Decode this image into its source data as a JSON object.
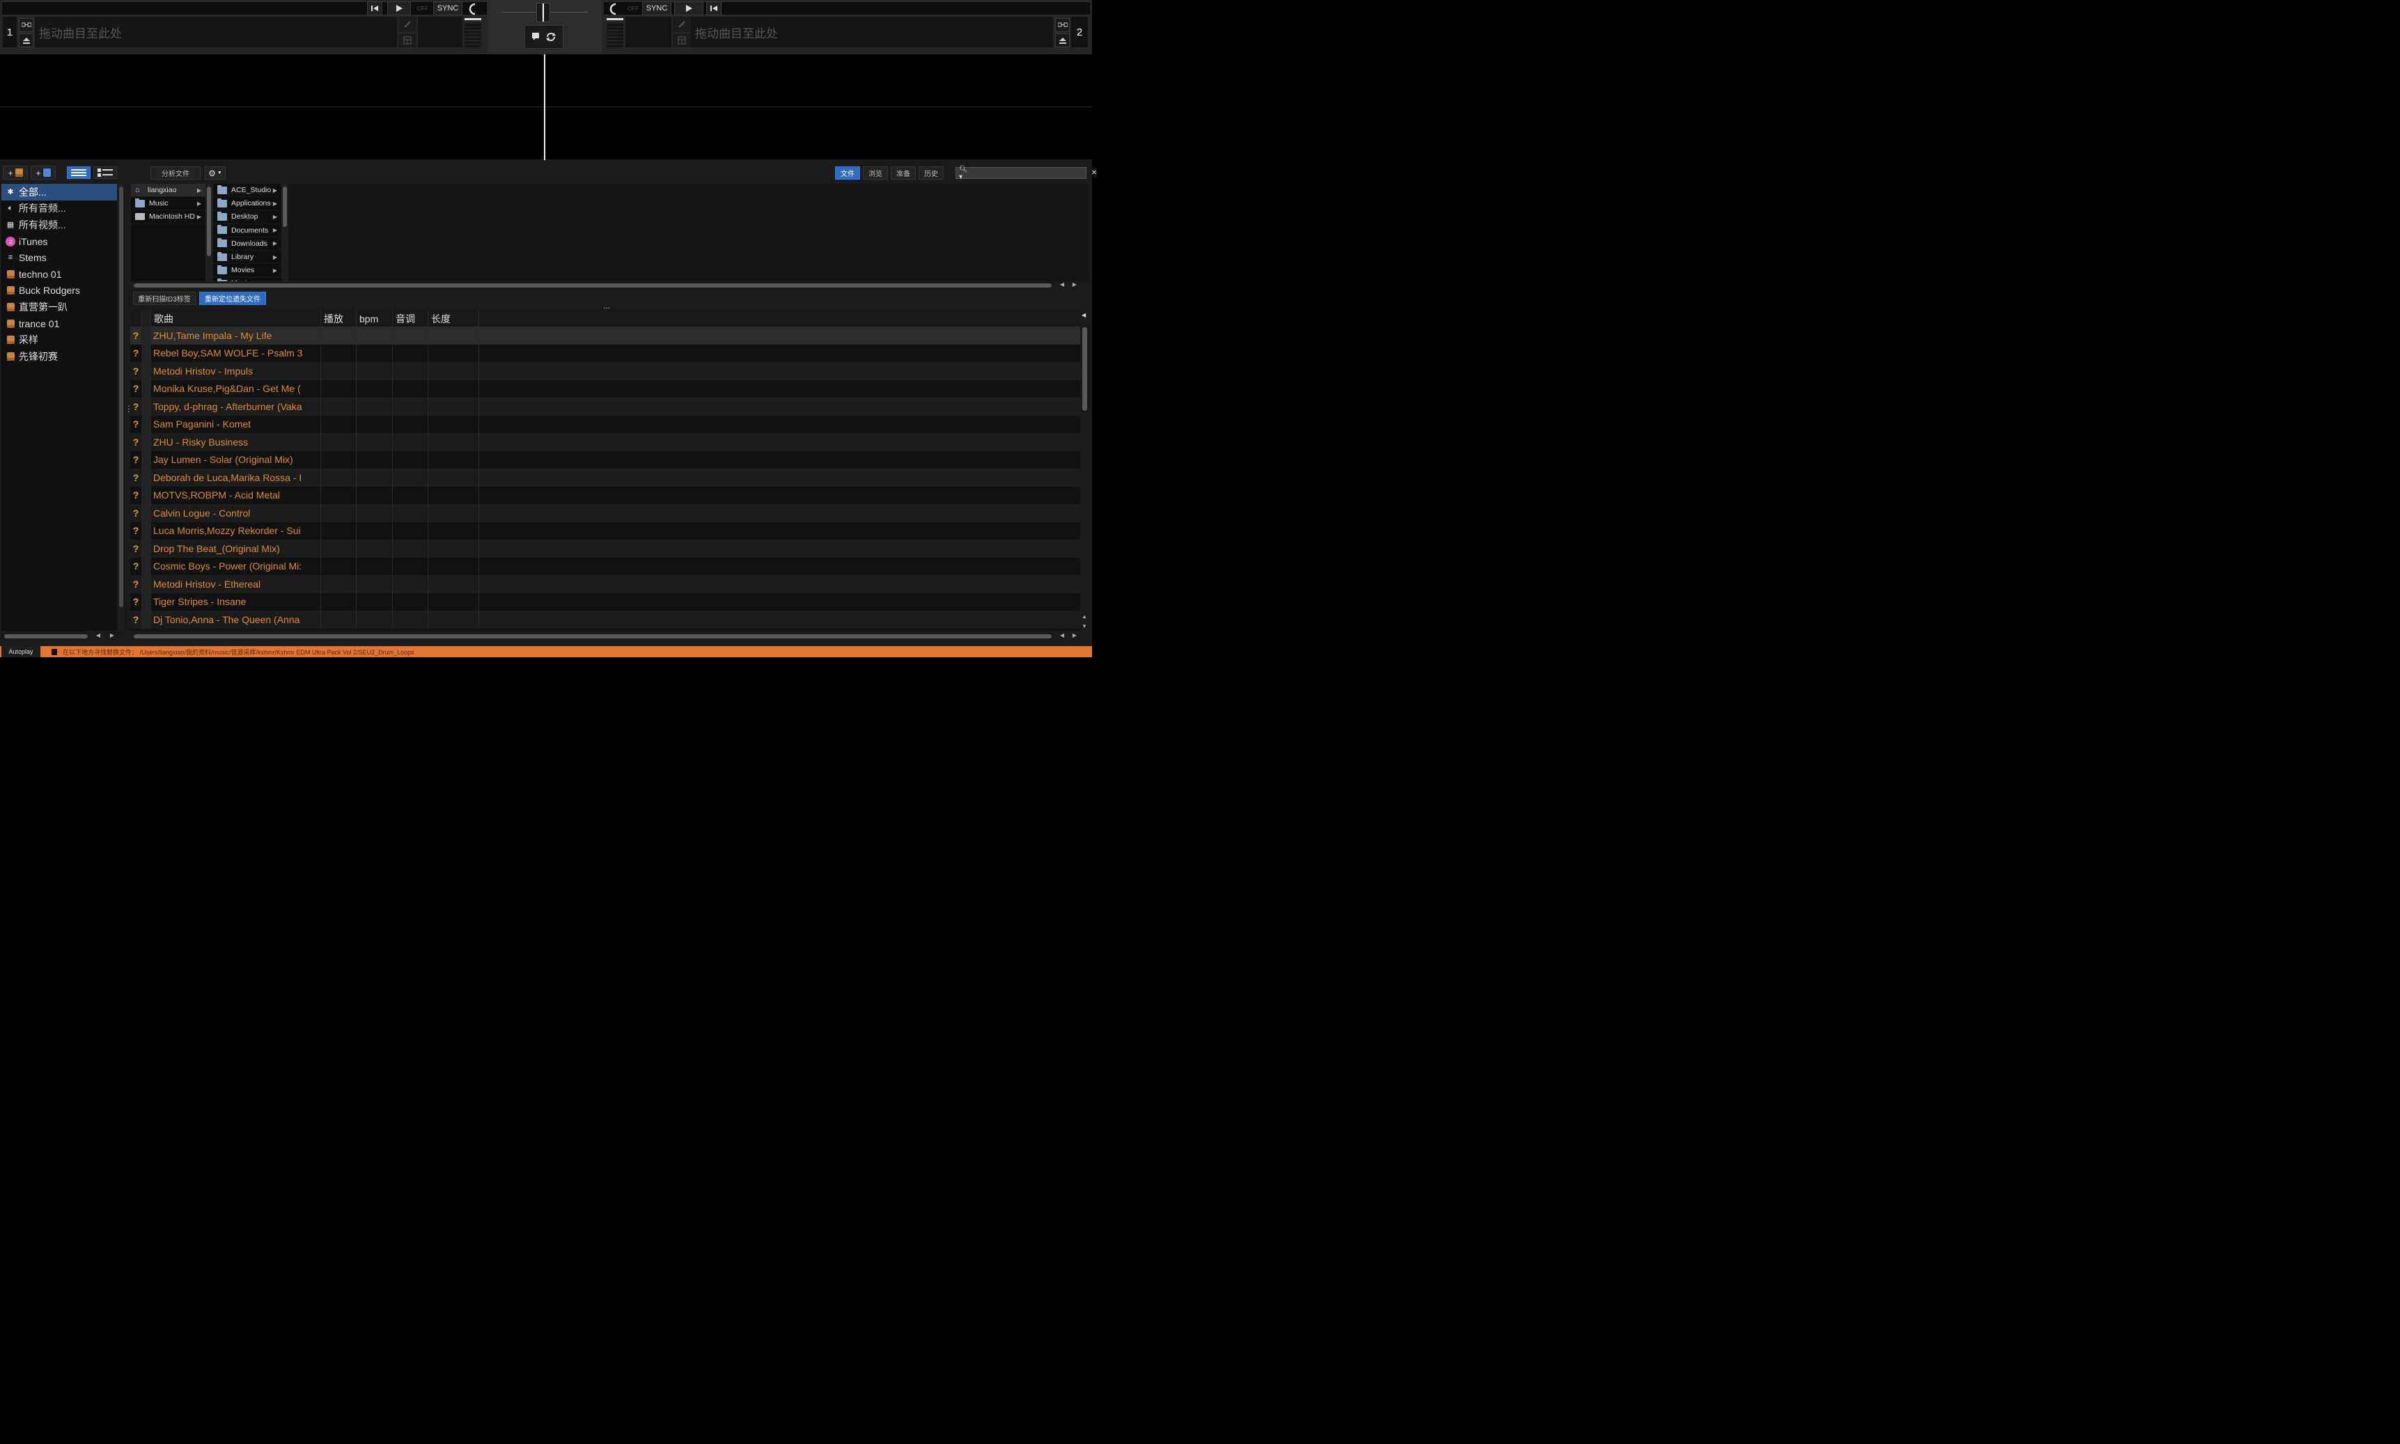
{
  "deck1": {
    "number": "1",
    "drop_hint": "拖动曲目至此处",
    "sync_label": "SYNC",
    "off_label": "OFF"
  },
  "deck2": {
    "number": "2",
    "drop_hint": "拖动曲目至此处",
    "sync_label": "SYNC",
    "off_label": "OFF"
  },
  "toolbar": {
    "analyze_label": "分析文件",
    "tabs": [
      {
        "label": "文件",
        "active": true
      },
      {
        "label": "浏览",
        "active": false
      },
      {
        "label": "准备",
        "active": false
      },
      {
        "label": "历史",
        "active": false
      }
    ],
    "search_placeholder": ""
  },
  "sidebar": {
    "items": [
      {
        "label": "全部...",
        "icon": "asterisk-icon",
        "selected": true
      },
      {
        "label": "所有音频...",
        "icon": "speaker-icon"
      },
      {
        "label": "所有视频...",
        "icon": "film-icon"
      },
      {
        "label": "iTunes",
        "icon": "itunes-icon"
      },
      {
        "label": "Stems",
        "icon": "stems-icon"
      },
      {
        "label": "techno 01",
        "icon": "crate-icon"
      },
      {
        "label": "Buck Rodgers",
        "icon": "crate-icon"
      },
      {
        "label": "直营第一趴",
        "icon": "crate-icon"
      },
      {
        "label": "trance 01",
        "icon": "crate-icon"
      },
      {
        "label": "采样",
        "icon": "crate-icon"
      },
      {
        "label": "先锋初赛",
        "icon": "crate-icon"
      }
    ]
  },
  "file_browser": {
    "col1": [
      {
        "label": "liangxiao",
        "icon": "home-icon",
        "selected": true
      },
      {
        "label": "Music",
        "icon": "folder-icon"
      },
      {
        "label": "Macintosh HD",
        "icon": "drive-icon"
      }
    ],
    "col2": [
      {
        "label": "ACE_Studio"
      },
      {
        "label": "Applications"
      },
      {
        "label": "Desktop"
      },
      {
        "label": "Documents"
      },
      {
        "label": "Downloads"
      },
      {
        "label": "Library"
      },
      {
        "label": "Movies"
      },
      {
        "label": "Music"
      }
    ],
    "rescan_label": "重新扫描ID3标签",
    "relocate_label": "重新定位遗失文件"
  },
  "tracklist": {
    "columns": {
      "title": "歌曲",
      "plays": "播放",
      "bpm": "bpm",
      "key": "音调",
      "length": "长度"
    },
    "rows": [
      {
        "status": "?",
        "title": "ZHU,Tame Impala - My Life"
      },
      {
        "status": "?",
        "title": "Rebel Boy,SAM WOLFE - Psalm 3"
      },
      {
        "status": "?",
        "title": "Metodi Hristov - Impuls"
      },
      {
        "status": "?",
        "title": "Monika Kruse,Pig&Dan - Get Me ("
      },
      {
        "status": "?",
        "title": "Toppy, d-phrag - Afterburner (Vaka"
      },
      {
        "status": "?",
        "title": "Sam Paganini - Komet"
      },
      {
        "status": "?",
        "title": "ZHU - Risky Business"
      },
      {
        "status": "?",
        "title": "Jay Lumen - Solar (Original Mix)"
      },
      {
        "status": "?",
        "title": "Deborah de Luca,Marika Rossa - I"
      },
      {
        "status": "?",
        "title": "MOTVS,ROBPM - Acid Metal"
      },
      {
        "status": "?",
        "title": "Calvin Logue - Control"
      },
      {
        "status": "?",
        "title": "Luca Morris,Mozzy Rekorder - Sui"
      },
      {
        "status": "?",
        "title": "Drop The Beat_(Original Mix)"
      },
      {
        "status": "?",
        "title": "Cosmic Boys - Power (Original Mi:"
      },
      {
        "status": "?",
        "title": "Metodi Hristov - Ethereal"
      },
      {
        "status": "?",
        "title": "Tiger Stripes - Insane"
      },
      {
        "status": "?",
        "title": "Dj Tonio,Anna - The Queen (Anna"
      }
    ]
  },
  "statusbar": {
    "autoplay_label": "Autoplay",
    "message": "在以下地方寻找替换文件：  /Users/liangxiao/我的资料/music/音源采样/kshmr/Kshmr EDM Ultra Pack Vol 2/SEU2_Drum_Loops"
  },
  "colors": {
    "accent": "#2d6bc5",
    "track_title": "#e08a2a",
    "status_bar": "#e27433"
  }
}
